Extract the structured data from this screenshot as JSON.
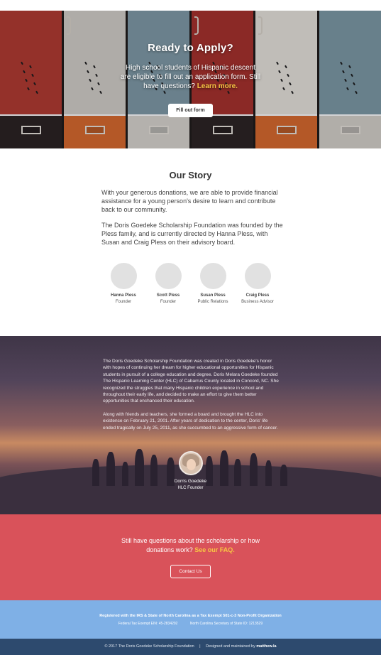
{
  "hero": {
    "title": "Ready to Apply?",
    "text": "High school students of Hispanic descent are eligible to fill out an application form. Still have questions?",
    "link_label": "Learn more.",
    "button_label": "Fill out form"
  },
  "story": {
    "title": "Our Story",
    "paragraph1": "With your generous donations, we are able to provide financial assistance for a young person's desire to learn and contribute back to our community.",
    "paragraph2": "The Doris Goedeke Scholarship Foundation was founded by the Pless family, and is currently directed by Hanna Pless, with Susan and Craig Pless on their advisory board.",
    "team": [
      {
        "name": "Hanna Pless",
        "role": "Founder"
      },
      {
        "name": "Scott Pless",
        "role": "Founder"
      },
      {
        "name": "Susan Pless",
        "role": "Public Relations"
      },
      {
        "name": "Craig Pless",
        "role": "Business Advisor"
      }
    ]
  },
  "history": {
    "paragraph1": "The Doris Goedeke Scholarship Foundation was created in Doris Goedeke's honor with hopes of continuing her dream for higher educational opportunities for Hispanic students in pursuit of a college education and degree. Doris Melara Goedeke founded The Hispanic Learning Center (HLC) of Cabarrus County located in Concord, NC. She recognized the struggles that many Hispanic children experience in school and throughout their early life, and decided to make an effort to give them better opportunities that enchanced their education.",
    "paragraph2": "Along with friends and teachers, she formed a board and brought the HLC into existence on February 21, 2001. After years of dedication to the center, Doris' life ended tragically on July 25, 2011, as she succumbed to an aggressive form of cancer.",
    "founder_name": "Dorris Goedeke",
    "founder_role": "HLC Founder"
  },
  "faq": {
    "text": "Still have questions about the scholarship or how donations work?",
    "link_label": "See our FAQ.",
    "button_label": "Contact Us"
  },
  "info": {
    "title": "Registered with the IRS & State of North Carolina as a Tax Exempt 501-c-3 Non-Profit Organization",
    "ein": "Federal Tax Exempt EIN: 45-2834292",
    "state_id": "North Carolina Secretary of State ID: 1213529"
  },
  "footer": {
    "copyright": "© 2017 The Doris Goedeke Scholarship Foundation",
    "separator": "|",
    "designed": "Designed and maintained by",
    "maker": "matthew.la"
  },
  "colors": {
    "accent_yellow": "#f7c544",
    "faq_red": "#d9525a",
    "info_blue": "#7fb0e6",
    "footer_navy": "#2d4a6e"
  }
}
